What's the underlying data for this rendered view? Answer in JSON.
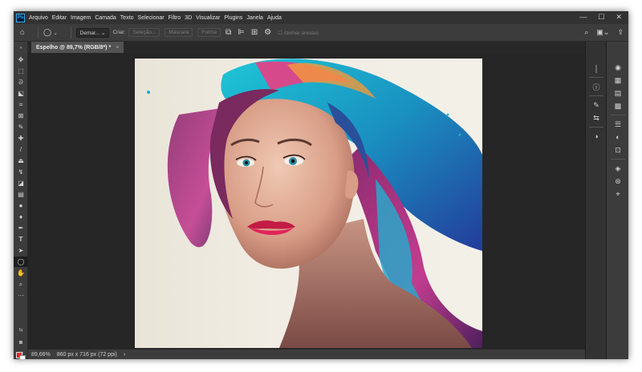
{
  "app": {
    "logo": "Ps"
  },
  "menu": [
    "Arquivo",
    "Editar",
    "Imagem",
    "Camada",
    "Texto",
    "Selecionar",
    "Filtro",
    "3D",
    "Visualizar",
    "Plugins",
    "Janela",
    "Ajuda"
  ],
  "window_controls": {
    "minimize": "—",
    "maximize": "☐",
    "close": "✕"
  },
  "options": {
    "feather_value": "Demar...",
    "criar_label": "Criar:",
    "selecao": "Seleção...",
    "mascara": "Máscara",
    "forma": "Forma",
    "alinhar": "Alinhar arestas"
  },
  "tab": {
    "title": "Espelho @ 89,7% (RGB/8*) *",
    "close": "×"
  },
  "status": {
    "zoom": "89,66%",
    "doc_info": "860 px x 716 px (72 ppi)",
    "arrow": "›"
  },
  "colors": {
    "foreground": "#e5161a",
    "background": "#ffffff"
  },
  "image": {
    "subject": "portrait of a woman with flowing teal, blue and magenta hair"
  }
}
